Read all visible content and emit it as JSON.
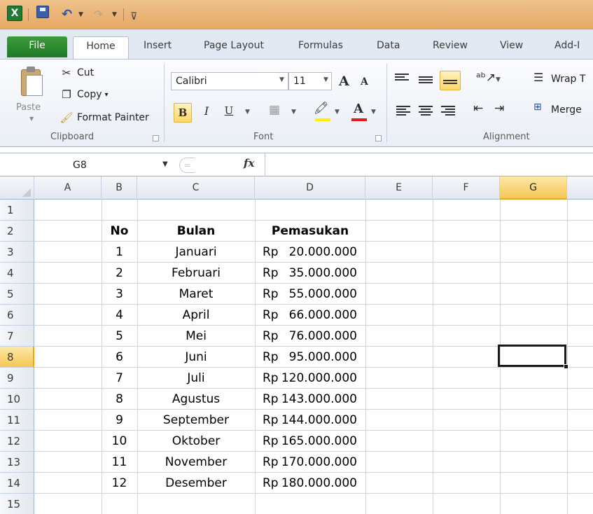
{
  "quick_access": {
    "logo_letter": "X"
  },
  "tabs": [
    "File",
    "Home",
    "Insert",
    "Page Layout",
    "Formulas",
    "Data",
    "Review",
    "View",
    "Add-I"
  ],
  "ribbon": {
    "clipboard": {
      "paste": "Paste",
      "cut": "Cut",
      "copy": "Copy",
      "copy_arrow": "▾",
      "format_painter": "Format Painter",
      "label": "Clipboard"
    },
    "font": {
      "name": "Calibri",
      "size": "11",
      "bold": "B",
      "italic": "I",
      "underline": "U",
      "grow": "A",
      "shrink": "A",
      "font_color": "A",
      "label": "Font"
    },
    "alignment": {
      "wrap": "Wrap T",
      "merge": "Merge",
      "label": "Alignment"
    }
  },
  "formula_bar": {
    "name_box": "G8",
    "fx": "fx",
    "value": ""
  },
  "columns": [
    "A",
    "B",
    "C",
    "D",
    "E",
    "F",
    "G"
  ],
  "selected_column": "G",
  "rows": [
    "1",
    "2",
    "3",
    "4",
    "5",
    "6",
    "7",
    "8",
    "9",
    "10",
    "11",
    "12",
    "13",
    "14",
    "15"
  ],
  "selected_row": "8",
  "table": {
    "headers": {
      "no": "No",
      "bulan": "Bulan",
      "pemasukan": "Pemasukan"
    },
    "currency": "Rp",
    "data": [
      {
        "no": "1",
        "bulan": "Januari",
        "amount": "20.000.000"
      },
      {
        "no": "2",
        "bulan": "Februari",
        "amount": "35.000.000"
      },
      {
        "no": "3",
        "bulan": "Maret",
        "amount": "55.000.000"
      },
      {
        "no": "4",
        "bulan": "April",
        "amount": "66.000.000"
      },
      {
        "no": "5",
        "bulan": "Mei",
        "amount": "76.000.000"
      },
      {
        "no": "6",
        "bulan": "Juni",
        "amount": "95.000.000"
      },
      {
        "no": "7",
        "bulan": "Juli",
        "amount": "120.000.000"
      },
      {
        "no": "8",
        "bulan": "Agustus",
        "amount": "143.000.000"
      },
      {
        "no": "9",
        "bulan": "September",
        "amount": "144.000.000"
      },
      {
        "no": "10",
        "bulan": "Oktober",
        "amount": "165.000.000"
      },
      {
        "no": "11",
        "bulan": "November",
        "amount": "170.000.000"
      },
      {
        "no": "12",
        "bulan": "Desember",
        "amount": "180.000.000"
      }
    ]
  }
}
